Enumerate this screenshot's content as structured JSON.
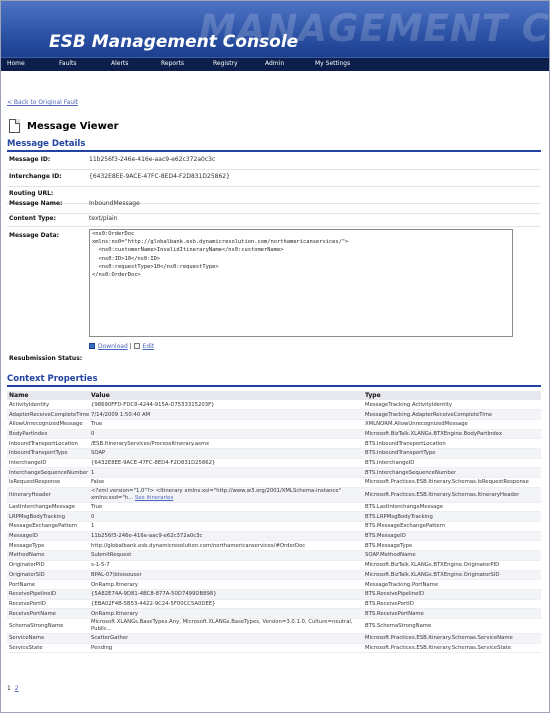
{
  "banner": {
    "title": "ESB Management Console",
    "ghost_text": "MANAGEMENT CONSO"
  },
  "nav": {
    "items": [
      "Home",
      "Faults",
      "Alerts",
      "Reports",
      "Registry",
      "Admin",
      "My Settings"
    ]
  },
  "back_link": "< Back to Original Fault",
  "page_title": "Message Viewer",
  "message_details": {
    "heading": "Message Details",
    "fields": [
      {
        "label": "Message ID:",
        "value": "11b256f3-246e-416e-aac9-e62c372a0c3c"
      },
      {
        "label": "Interchange ID:",
        "value": "{6432E8EE-9ACE-47FC-8ED4-F2D831D25862}"
      },
      {
        "label": "Routing URL:",
        "value": ""
      },
      {
        "label": "Message Name:",
        "value": "InboundMessage"
      },
      {
        "label": "Content Type:",
        "value": "text/plain"
      }
    ],
    "data_label": "Message Data:",
    "xml_lines": [
      "<ns0:OrderDoc",
      "xmlns:ns0=\"http://globalbank.esb.dynamicresolution.com/northamericanservices/\">",
      "  <ns0:customerName>InvalidItineraryName</ns0:customerName>",
      "  <ns0:ID>10</ns0:ID>",
      "  <ns0:requestType>10</ns0:requestType>",
      "</ns0:OrderDoc>"
    ],
    "download_label": "Download",
    "separator": "|",
    "edit_label": "Edit",
    "resubmission_label": "Resubmission Status:"
  },
  "context": {
    "heading": "Context Properties",
    "columns": [
      "Name",
      "Value",
      "Type"
    ],
    "rows": [
      {
        "name": "ActivityIdentity",
        "value": "{98690FFD-FDC8-4244-915A-D7533315203F}",
        "type": "MessageTracking.ActivityIdentity"
      },
      {
        "name": "AdapterReceiveCompleteTime",
        "value": "7/14/2009 1:50:40 AM",
        "type": "MessageTracking.AdapterReceiveCompleteTime"
      },
      {
        "name": "AllowUnrecognizedMessage",
        "value": "True",
        "type": "XMLNORM.AllowUnrecognizedMessage"
      },
      {
        "name": "BodyPartIndex",
        "value": "0",
        "type": "Microsoft.BizTalk.XLANGs.BTXEngine.BodyPartIndex"
      },
      {
        "name": "InboundTransportLocation",
        "value": "/ESB.ItineraryServices/ProcessItinerary.asmx",
        "type": "BTS.InboundTransportLocation"
      },
      {
        "name": "InboundTransportType",
        "value": "SOAP",
        "type": "BTS.InboundTransportType"
      },
      {
        "name": "InterchangeID",
        "value": "{6432E8EE-9ACE-47FC-8ED4-F2D831D25862}",
        "type": "BTS.InterchangeID"
      },
      {
        "name": "InterchangeSequenceNumber",
        "value": "1",
        "type": "BTS.InterchangeSequenceNumber"
      },
      {
        "name": "IsRequestResponse",
        "value": "False",
        "type": "Microsoft.Practices.ESB.Itinerary.Schemas.IsRequestResponse"
      },
      {
        "name": "ItineraryHeader",
        "value": "<?xml version=\"1.0\"?> <Itinerary xmlns:xsi=\"http://www.w3.org/2001/XMLSchema-instance\" xmlns:xsd=\"h...",
        "value_link": "See itineraries",
        "type": "Microsoft.Practices.ESB.Itinerary.Schemas.ItineraryHeader"
      },
      {
        "name": "LastInterchangeMessage",
        "value": "True",
        "type": "BTS.LastInterchangeMessage"
      },
      {
        "name": "LRPMsgBodyTracking",
        "value": "0",
        "type": "BTS.LRPMsgBodyTracking"
      },
      {
        "name": "MessageExchangePattern",
        "value": "1",
        "type": "BTS.MessageExchangePattern"
      },
      {
        "name": "MessageID",
        "value": "11b256f3-246e-416e-aac9-e62c372a0c3c",
        "type": "BTS.MessageID"
      },
      {
        "name": "MessageType",
        "value": "http://globalbank.esb.dynamicresolution.com/northamericanservices/#OrderDoc",
        "type": "BTS.MessageType"
      },
      {
        "name": "MethodName",
        "value": "SubmitRequest",
        "type": "SOAP.MethodName"
      },
      {
        "name": "OriginatorPID",
        "value": "s-1-5-7",
        "type": "Microsoft.BizTalk.XLANGs.BTXEngine.OriginatorPID"
      },
      {
        "name": "OriginatorSID",
        "value": "BPAL-07\\btsisouser",
        "type": "Microsoft.BizTalk.XLANGs.BTXEngine.OriginatorSID"
      },
      {
        "name": "PortName",
        "value": "OnRamp.Itinerary",
        "type": "MessageTracking.PortName"
      },
      {
        "name": "ReceivePipelineID",
        "value": "{5A82E74A-9D81-4BC8-877A-50D7499DB898}",
        "type": "BTS.ReceivePipelineID"
      },
      {
        "name": "ReceivePortID",
        "value": "{EBA02F4B-5B53-4422-9C24-5F00CC5A0DEE}",
        "type": "BTS.ReceivePortID"
      },
      {
        "name": "ReceivePortName",
        "value": "OnRamp.Itinerary",
        "type": "BTS.ReceivePortName"
      },
      {
        "name": "SchemaStrongName",
        "value": "Microsoft.XLANGs.BaseTypes.Any, Microsoft.XLANGs.BaseTypes, Version=3.0.1.0, Culture=neutral, Public...",
        "type": "BTS.SchemaStrongName"
      },
      {
        "name": "ServiceName",
        "value": "ScatterGather",
        "type": "Microsoft.Practices.ESB.Itinerary.Schemas.ServiceName"
      },
      {
        "name": "ServiceState",
        "value": "Pending",
        "type": "Microsoft.Practices.ESB.Itinerary.Schemas.ServiceState"
      }
    ]
  },
  "pager": {
    "current": "1",
    "next": "2"
  },
  "colors": {
    "banner": "#2f55a8",
    "nav": "#0c1f4c",
    "heading": "#2344a0",
    "link": "#4a64b8"
  }
}
